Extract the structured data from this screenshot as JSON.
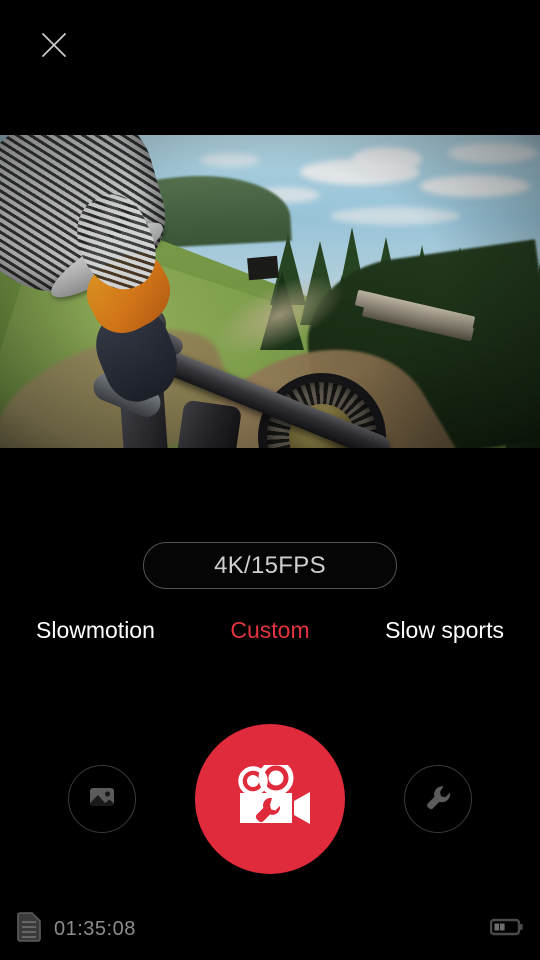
{
  "app": {
    "title": "Action Camera",
    "background_color": "#000000",
    "accent_color": "#e02b3c"
  },
  "topbar": {
    "close_label": "Close",
    "close_icon": "close-x-icon"
  },
  "preview": {
    "kind": "live-camera-preview",
    "description": "POV mountain biking shot down a grassy hillside trail with pine trees and blue sky"
  },
  "controls": {
    "resolution": {
      "value": "4K/15FPS",
      "text_color": "#cfcfcf",
      "border_color": "#545454"
    },
    "modes": [
      {
        "label": "Slowmotion",
        "active": false,
        "color": "#ffffff"
      },
      {
        "label": "Custom",
        "active": true,
        "color": "#e2333f"
      },
      {
        "label": "Slow sports",
        "active": false,
        "color": "#ffffff"
      }
    ],
    "gallery_button": {
      "label": "Gallery",
      "icon": "image-icon"
    },
    "record_button": {
      "label": "Record",
      "icon": "video-camera-wrench-icon",
      "color": "#e02b3c"
    },
    "settings_button": {
      "label": "Settings",
      "icon": "wrench-icon"
    }
  },
  "statusbar": {
    "storage_icon": "storage-card-icon",
    "remaining_time": "01:35:08",
    "battery_icon": "battery-icon",
    "battery_level_percent": 40,
    "text_color": "#8c8c8c"
  }
}
